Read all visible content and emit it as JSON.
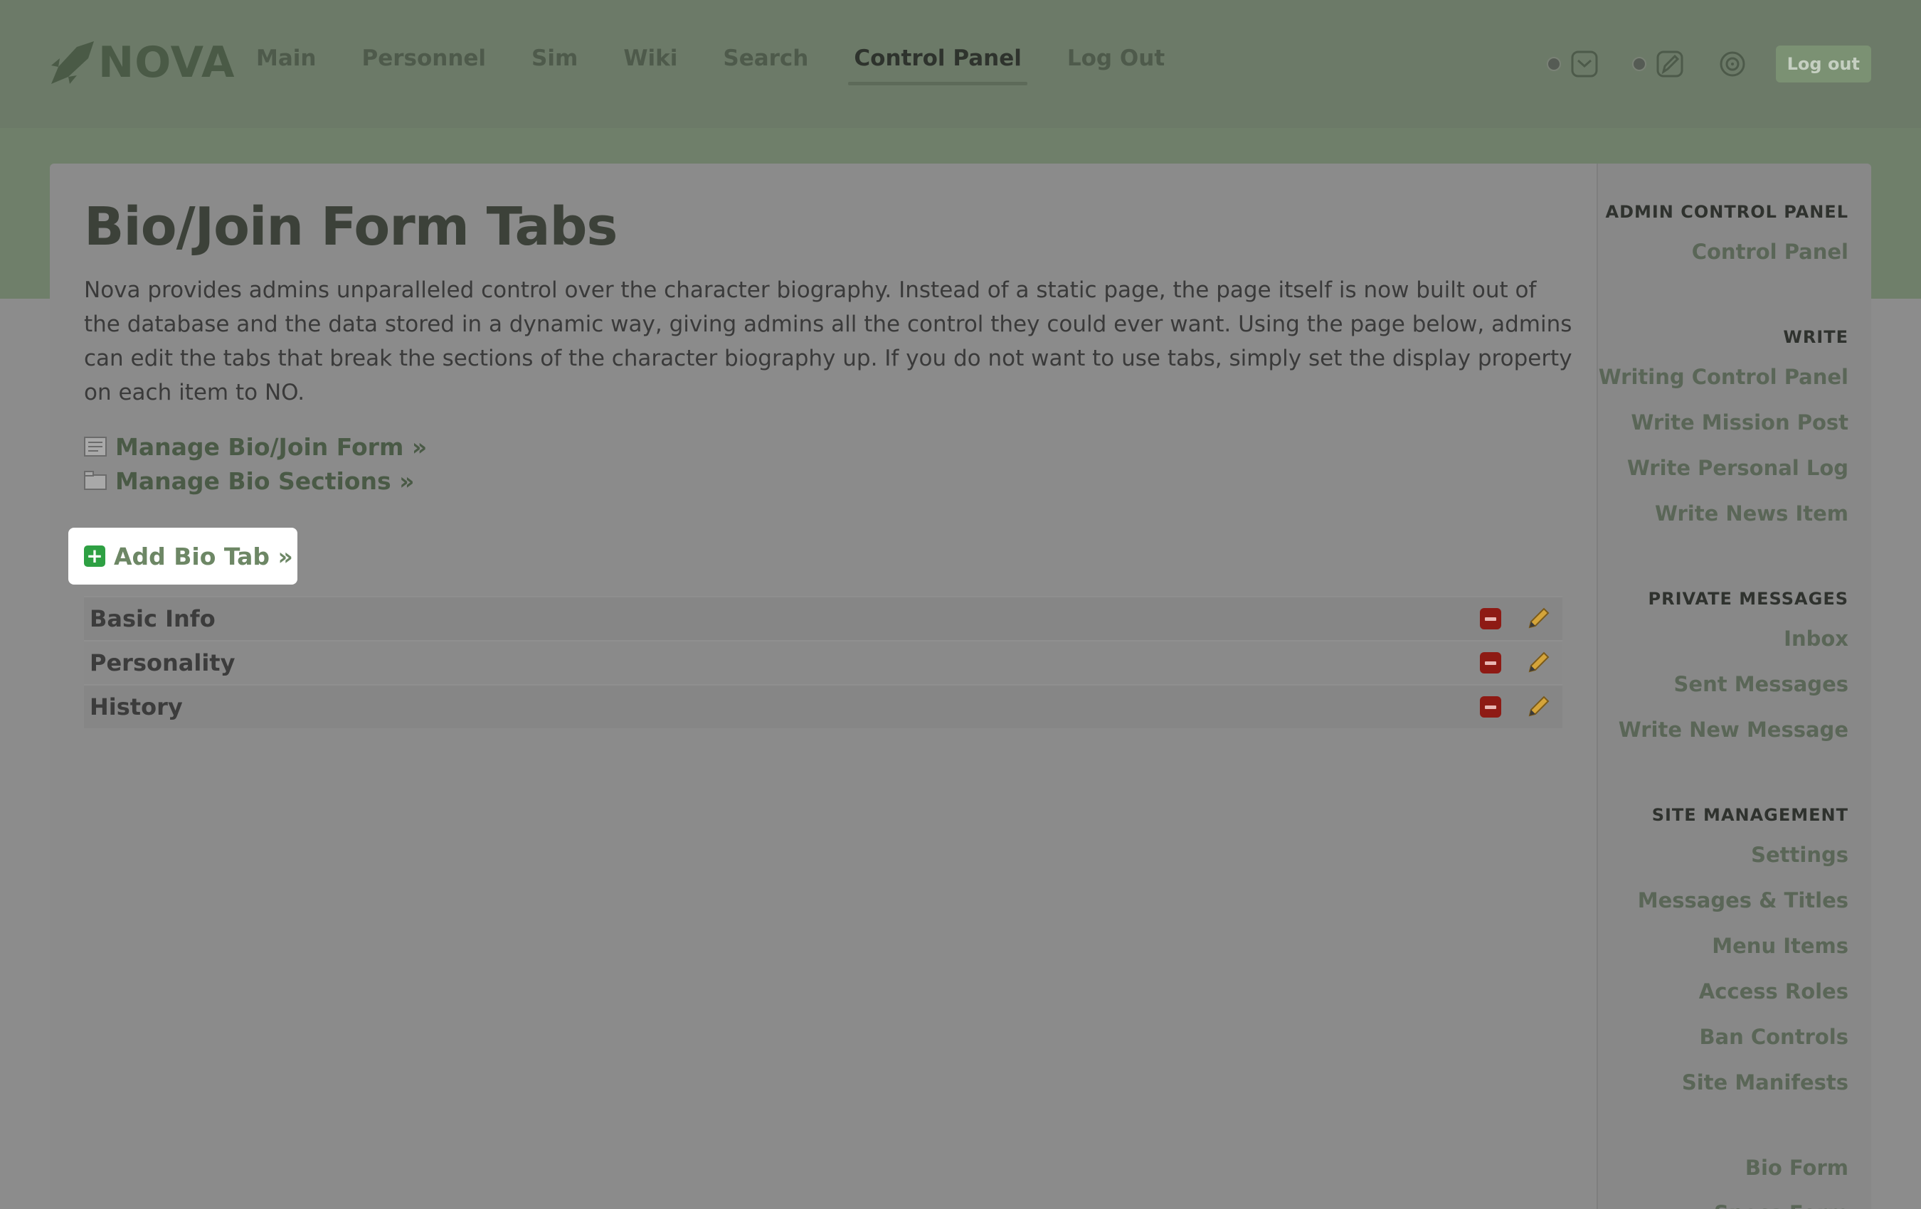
{
  "brand": {
    "name": "NOVA"
  },
  "nav": {
    "items": [
      {
        "label": "Main"
      },
      {
        "label": "Personnel"
      },
      {
        "label": "Sim"
      },
      {
        "label": "Wiki"
      },
      {
        "label": "Search"
      },
      {
        "label": "Control Panel",
        "active": true
      },
      {
        "label": "Log Out"
      }
    ],
    "logout_button": "Log out",
    "icons": [
      "inbox-icon",
      "write-icon",
      "settings-icon"
    ]
  },
  "page": {
    "title": "Bio/Join Form Tabs",
    "intro": "Nova provides admins unparalleled control over the character biography. Instead of a static page, the page itself is now built out of the database and the data stored in a dynamic way, giving admins all the control they could ever want. Using the page below, admins can edit the tabs that break the sections of the character biography up. If you do not want to use tabs, simply set the display property on each item to NO.",
    "links": [
      {
        "label": "Manage Bio/Join Form »",
        "icon": "form-icon"
      },
      {
        "label": "Manage Bio Sections »",
        "icon": "sections-icon"
      }
    ],
    "add_tab": {
      "label": "Add Bio Tab »",
      "icon": "add-icon"
    },
    "tabs": [
      {
        "name": "Basic Info"
      },
      {
        "name": "Personality"
      },
      {
        "name": "History"
      }
    ]
  },
  "sidebar": {
    "sections": [
      {
        "heading": "ADMIN CONTROL PANEL",
        "items": [
          "Control Panel"
        ]
      },
      {
        "heading": "WRITE",
        "items": [
          "Writing Control Panel",
          "Write Mission Post",
          "Write Personal Log",
          "Write News Item"
        ]
      },
      {
        "heading": "PRIVATE MESSAGES",
        "items": [
          "Inbox",
          "Sent Messages",
          "Write New Message"
        ]
      },
      {
        "heading": "SITE MANAGEMENT",
        "items": [
          "Settings",
          "Messages & Titles",
          "Menu Items",
          "Access Roles",
          "Ban Controls",
          "Site Manifests"
        ]
      },
      {
        "heading": "",
        "items": [
          "Bio Form",
          "Specs Form"
        ]
      }
    ]
  },
  "colors": {
    "topbar": "#6c7a68",
    "accent": "#4a5a46",
    "add_icon": "#2ea043",
    "delete_icon": "#8e1a14"
  }
}
